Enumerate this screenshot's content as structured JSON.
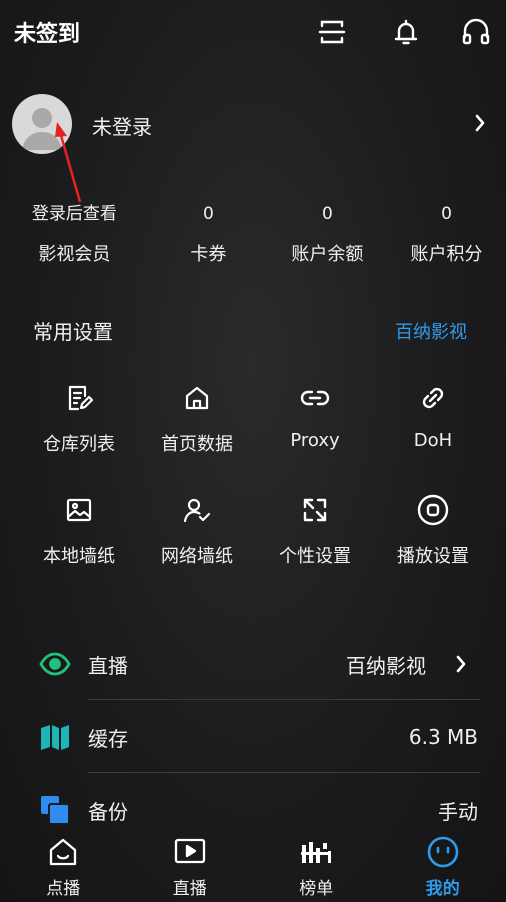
{
  "header": {
    "title": "未签到",
    "icons": [
      "scan-icon",
      "bell-icon",
      "headphones-icon"
    ]
  },
  "profile": {
    "login_text": "未登录"
  },
  "stats": [
    {
      "value": "登录后查看",
      "label": "影视会员"
    },
    {
      "value": "0",
      "label": "卡券"
    },
    {
      "value": "0",
      "label": "账户余额"
    },
    {
      "value": "0",
      "label": "账户积分"
    }
  ],
  "settings": {
    "title": "常用设置",
    "link": "百纳影视",
    "items": [
      {
        "label": "仓库列表",
        "icon": "edit-doc-icon"
      },
      {
        "label": "首页数据",
        "icon": "home-icon"
      },
      {
        "label": "Proxy",
        "icon": "link-icon"
      },
      {
        "label": "DoH",
        "icon": "chain-icon"
      },
      {
        "label": "本地墙纸",
        "icon": "image-icon"
      },
      {
        "label": "网络墙纸",
        "icon": "user-check-icon"
      },
      {
        "label": "个性设置",
        "icon": "expand-icon"
      },
      {
        "label": "播放设置",
        "icon": "stop-circle-icon"
      }
    ]
  },
  "list": [
    {
      "label": "直播",
      "value": "百纳影视",
      "icon": "eye-icon",
      "color": "#22c07a"
    },
    {
      "label": "缓存",
      "value": "6.3 MB",
      "icon": "map-icon",
      "color": "#1fb5b8"
    },
    {
      "label": "备份",
      "value": "手动",
      "icon": "copy-icon",
      "color": "#2f8cf0"
    }
  ],
  "nav": [
    {
      "label": "点播",
      "icon": "home-smile-icon"
    },
    {
      "label": "直播",
      "icon": "play-icon"
    },
    {
      "label": "榜单",
      "icon": "chart-icon"
    },
    {
      "label": "我的",
      "icon": "face-icon"
    }
  ],
  "colors": {
    "accent": "#2f9bea",
    "background": "#1c1c1e"
  }
}
